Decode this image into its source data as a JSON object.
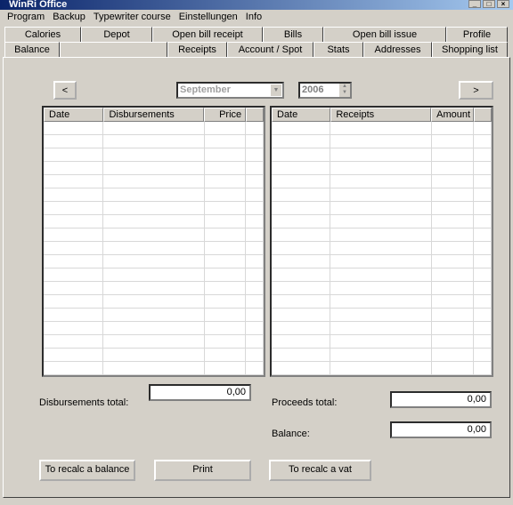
{
  "window": {
    "title": "WinRi Office",
    "controls": [
      "_",
      "□",
      "×"
    ]
  },
  "menu": [
    "Program",
    "Backup",
    "Typewriter course",
    "Einstellungen",
    "Info"
  ],
  "tabs_row1": [
    "Calories",
    "Depot",
    "Open bill receipt",
    "Bills",
    "Open bill issue",
    "Profile"
  ],
  "tabs_row2": [
    "Balance",
    "",
    "Receipts",
    "Account / Spot",
    "Stats",
    "Addresses",
    "Shopping list"
  ],
  "nav": {
    "prev": "<",
    "month": "September",
    "year": "2006",
    "next": ">"
  },
  "left_grid": {
    "columns": [
      "Date",
      "Disbursements",
      "Price"
    ]
  },
  "right_grid": {
    "columns": [
      "Date",
      "Receipts",
      "Amount"
    ]
  },
  "totals": {
    "disbursements_label": "Disbursements total:",
    "disbursements_value": "0,00",
    "proceeds_label": "Proceeds total:",
    "proceeds_value": "0,00",
    "balance_label": "Balance:",
    "balance_value": "0,00"
  },
  "buttons": {
    "recalc_balance": "To recalc a balance",
    "print": "Print",
    "recalc_vat": "To recalc a vat"
  }
}
